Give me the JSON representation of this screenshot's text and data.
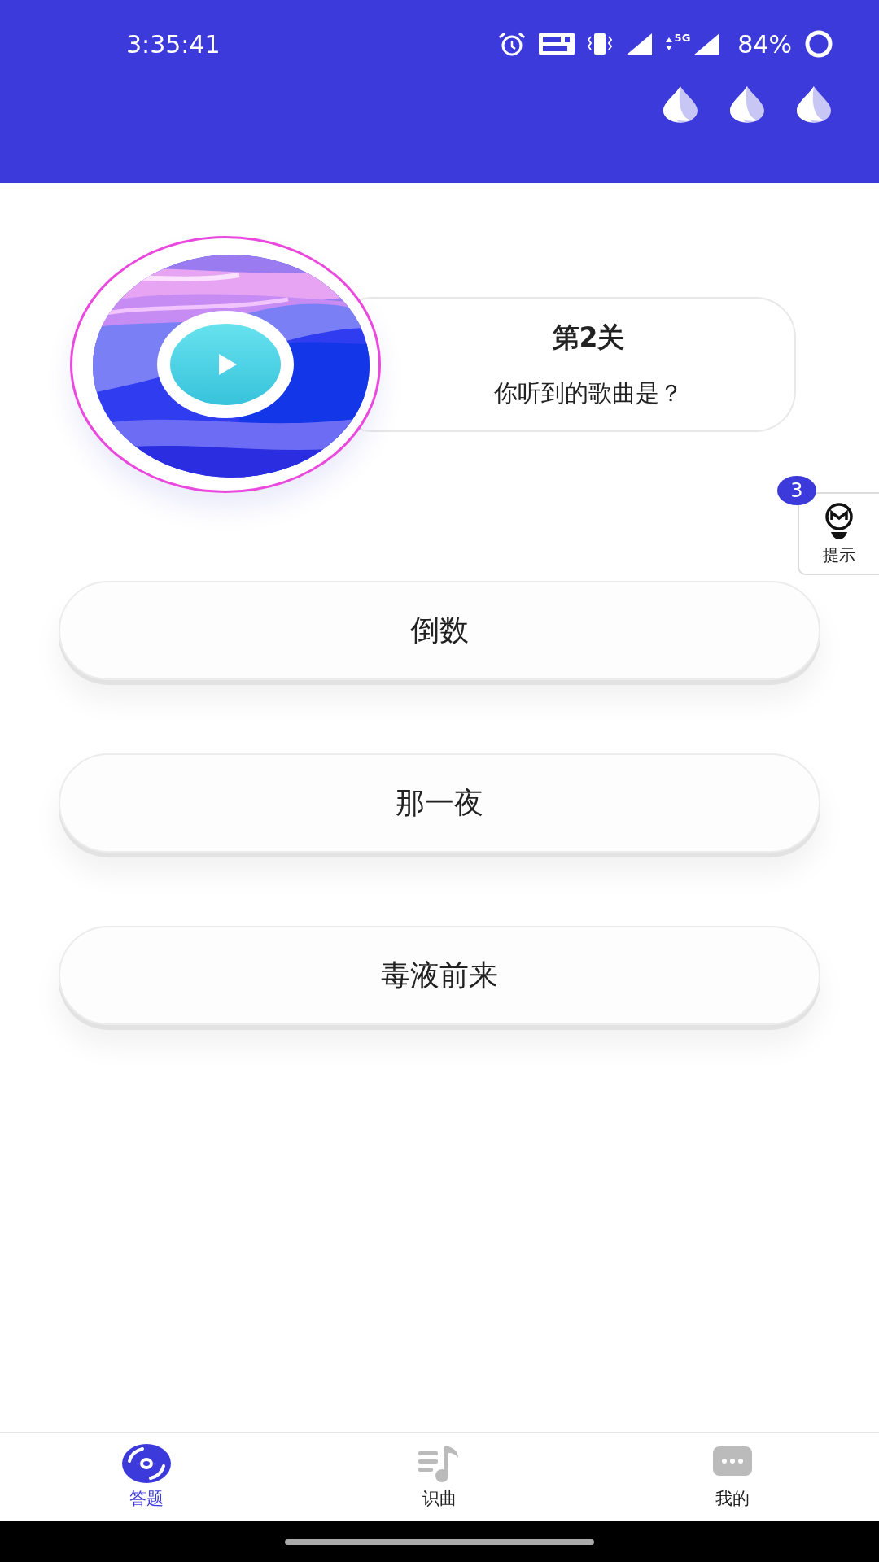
{
  "status_bar": {
    "time": "3:35:41",
    "network": "5G",
    "battery": "84%"
  },
  "level": {
    "title": "第2关",
    "question": "你听到的歌曲是？"
  },
  "hint": {
    "count": "3",
    "label": "提示"
  },
  "options": [
    {
      "label": "倒数"
    },
    {
      "label": "那一夜"
    },
    {
      "label": "毒液前来"
    }
  ],
  "nav": [
    {
      "label": "答题",
      "selected": true
    },
    {
      "label": "识曲",
      "selected": false
    },
    {
      "label": "我的",
      "selected": false
    }
  ]
}
